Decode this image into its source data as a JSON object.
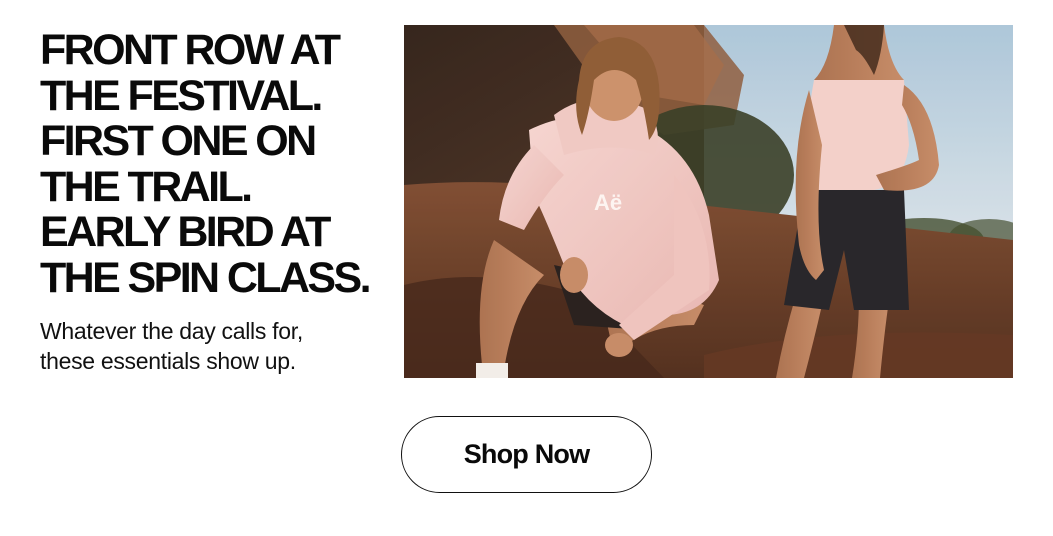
{
  "promo": {
    "headline_lines": [
      "FRONT ROW AT",
      "THE FESTIVAL.",
      "FIRST ONE ON",
      "THE TRAIL.",
      "EARLY BIRD AT",
      "THE SPIN CLASS."
    ],
    "subcopy_lines": [
      "Whatever the day calls for,",
      "these essentials show up."
    ],
    "hoodie_logo": "Aë",
    "cta_label": "Shop Now"
  },
  "colors": {
    "text": "#0a0a0a",
    "background": "#ffffff",
    "button_border": "#111111"
  }
}
